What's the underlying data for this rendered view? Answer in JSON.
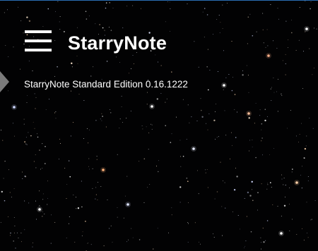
{
  "app": {
    "title": "StarryNote",
    "edition": "StarryNote Standard Edition 0.16.1222"
  },
  "icons": {
    "menu": "hamburger-menu-icon",
    "side_tab": "triangle-right-icon"
  },
  "colors": {
    "background": "#020203",
    "text": "#ffffff",
    "window_border": "#2a6db3",
    "side_tab": "#7a7a7a"
  }
}
